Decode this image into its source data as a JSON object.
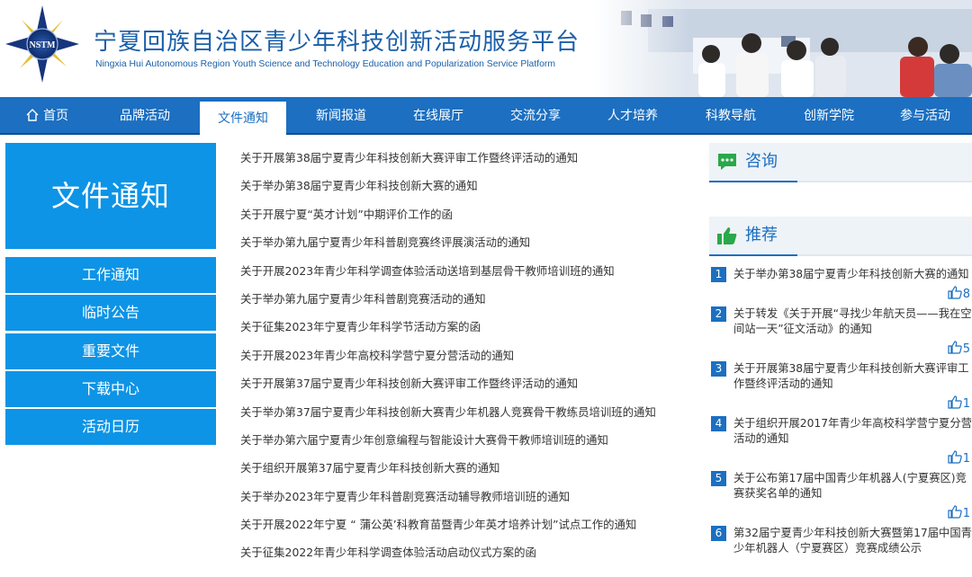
{
  "header": {
    "title": "宁夏回族自治区青少年科技创新活动服务平台",
    "subtitle": "Ningxia Hui Autonomous Region Youth Science and Technology Education and Popularization Service Platform",
    "logo_text": "NSTM"
  },
  "nav": {
    "items": [
      {
        "label": "首页",
        "icon": "home-icon"
      },
      {
        "label": "品牌活动"
      },
      {
        "label": "文件通知"
      },
      {
        "label": "新闻报道"
      },
      {
        "label": "在线展厅"
      },
      {
        "label": "交流分享"
      },
      {
        "label": "人才培养"
      },
      {
        "label": "科教导航"
      },
      {
        "label": "创新学院"
      },
      {
        "label": "参与活动"
      }
    ],
    "active": "文件通知"
  },
  "left": {
    "section_title": "文件通知",
    "menu": [
      "工作通知",
      "临时公告",
      "重要文件",
      "下载中心",
      "活动日历"
    ]
  },
  "list": [
    "关于开展第38届宁夏青少年科技创新大赛评审工作暨终评活动的通知",
    "关于举办第38届宁夏青少年科技创新大赛的通知",
    "关于开展宁夏“英才计划”中期评价工作的函",
    "关于举办第九届宁夏青少年科普剧竞赛终评展演活动的通知",
    "关于开展2023年青少年科学调查体验活动送培到基层骨干教师培训班的通知",
    "关于举办第九届宁夏青少年科普剧竞赛活动的通知",
    "关于征集2023年宁夏青少年科学节活动方案的函",
    "关于开展2023年青少年高校科学营宁夏分营活动的通知",
    "关于开展第37届宁夏青少年科技创新大赛评审工作暨终评活动的通知",
    "关于举办第37届宁夏青少年科技创新大赛青少年机器人竞赛骨干教练员培训班的通知",
    "关于举办第六届宁夏青少年创意编程与智能设计大赛骨干教师培训班的通知",
    "关于组织开展第37届宁夏青少年科技创新大赛的通知",
    "关于举办2023年宁夏青少年科普剧竞赛活动辅导教师培训班的通知",
    "关于开展2022年宁夏 “ 蒲公英’科教育苗暨青少年英才培养计划”试点工作的通知",
    "关于征集2022年青少年科学调查体验活动启动仪式方案的函"
  ],
  "right": {
    "consult_title": "咨询",
    "recommend_title": "推荐",
    "recommend": [
      {
        "num": "1",
        "text": "关于举办第38届宁夏青少年科技创新大赛的通知",
        "likes": "8"
      },
      {
        "num": "2",
        "text": "关于转发《关于开展“寻找少年航天员——我在空间站一天”征文活动》的通知",
        "likes": "5"
      },
      {
        "num": "3",
        "text": "关于开展第38届宁夏青少年科技创新大赛评审工作暨终评活动的通知",
        "likes": "1"
      },
      {
        "num": "4",
        "text": "关于组织开展2017年青少年高校科学营宁夏分营活动的通知",
        "likes": "1"
      },
      {
        "num": "5",
        "text": "关于公布第17届中国青少年机器人(宁夏赛区)竞赛获奖名单的通知",
        "likes": "1"
      },
      {
        "num": "6",
        "text": "第32届宁夏青少年科技创新大赛暨第17届中国青少年机器人（宁夏赛区）竞赛成绩公示",
        "likes": ""
      }
    ]
  },
  "colors": {
    "primary": "#1c6fc1",
    "accent": "#0d94e6"
  }
}
